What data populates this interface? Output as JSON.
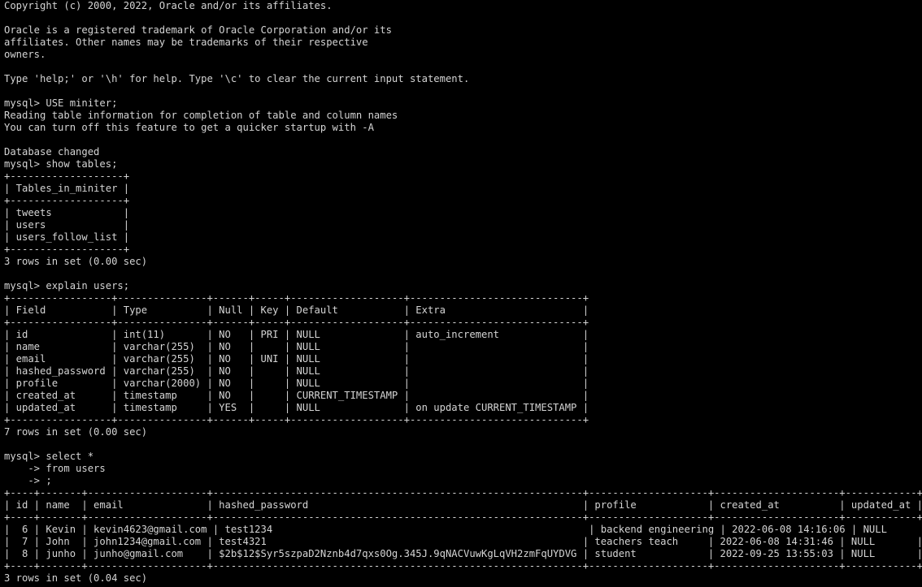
{
  "terminal": {
    "lines": [
      "Copyright (c) 2000, 2022, Oracle and/or its affiliates.",
      "",
      "Oracle is a registered trademark of Oracle Corporation and/or its",
      "affiliates. Other names may be trademarks of their respective",
      "owners.",
      "",
      "Type 'help;' or '\\h' for help. Type '\\c' to clear the current input statement.",
      "",
      "mysql> USE miniter;",
      "Reading table information for completion of table and column names",
      "You can turn off this feature to get a quicker startup with -A",
      "",
      "Database changed",
      "mysql> show tables;",
      "+-------------------+",
      "| Tables_in_miniter |",
      "+-------------------+",
      "| tweets            |",
      "| users             |",
      "| users_follow_list |",
      "+-------------------+",
      "3 rows in set (0.00 sec)",
      "",
      "mysql> explain users;",
      "+-----------------+---------------+------+-----+-------------------+-----------------------------+",
      "| Field           | Type          | Null | Key | Default           | Extra                       |",
      "+-----------------+---------------+------+-----+-------------------+-----------------------------+",
      "| id              | int(11)       | NO   | PRI | NULL              | auto_increment              |",
      "| name            | varchar(255)  | NO   |     | NULL              |                             |",
      "| email           | varchar(255)  | NO   | UNI | NULL              |                             |",
      "| hashed_password | varchar(255)  | NO   |     | NULL              |                             |",
      "| profile         | varchar(2000) | NO   |     | NULL              |                             |",
      "| created_at      | timestamp     | NO   |     | CURRENT_TIMESTAMP |                             |",
      "| updated_at      | timestamp     | YES  |     | NULL              | on update CURRENT_TIMESTAMP |",
      "+-----------------+---------------+------+-----+-------------------+-----------------------------+",
      "7 rows in set (0.00 sec)",
      "",
      "mysql> select *",
      "    -> from users",
      "    -> ;",
      "+----+-------+--------------------+--------------------------------------------------------------+--------------------+---------------------+------------+",
      "| id | name  | email              | hashed_password                                              | profile            | created_at          | updated_at |",
      "+----+-------+--------------------+--------------------------------------------------------------+--------------------+---------------------+------------+",
      "|  6 | Kevin | kevin4623@gmail.com | test1234                                                     | backend engineering | 2022-06-08 14:16:06 | NULL       |",
      "|  7 | John  | john1234@gmail.com | test4321                                                     | teachers teach     | 2022-06-08 14:31:46 | NULL       |",
      "|  8 | junho | junho@gmail.com    | $2b$12$Syr5szpaD2Nznb4d7qxs0Og.345J.9qNACVuwKgLqVH2zmFqUYDVG | student            | 2022-09-25 13:55:03 | NULL       |",
      "+----+-------+--------------------+--------------------------------------------------------------+--------------------+---------------------+------------+",
      "3 rows in set (0.04 sec)"
    ]
  }
}
